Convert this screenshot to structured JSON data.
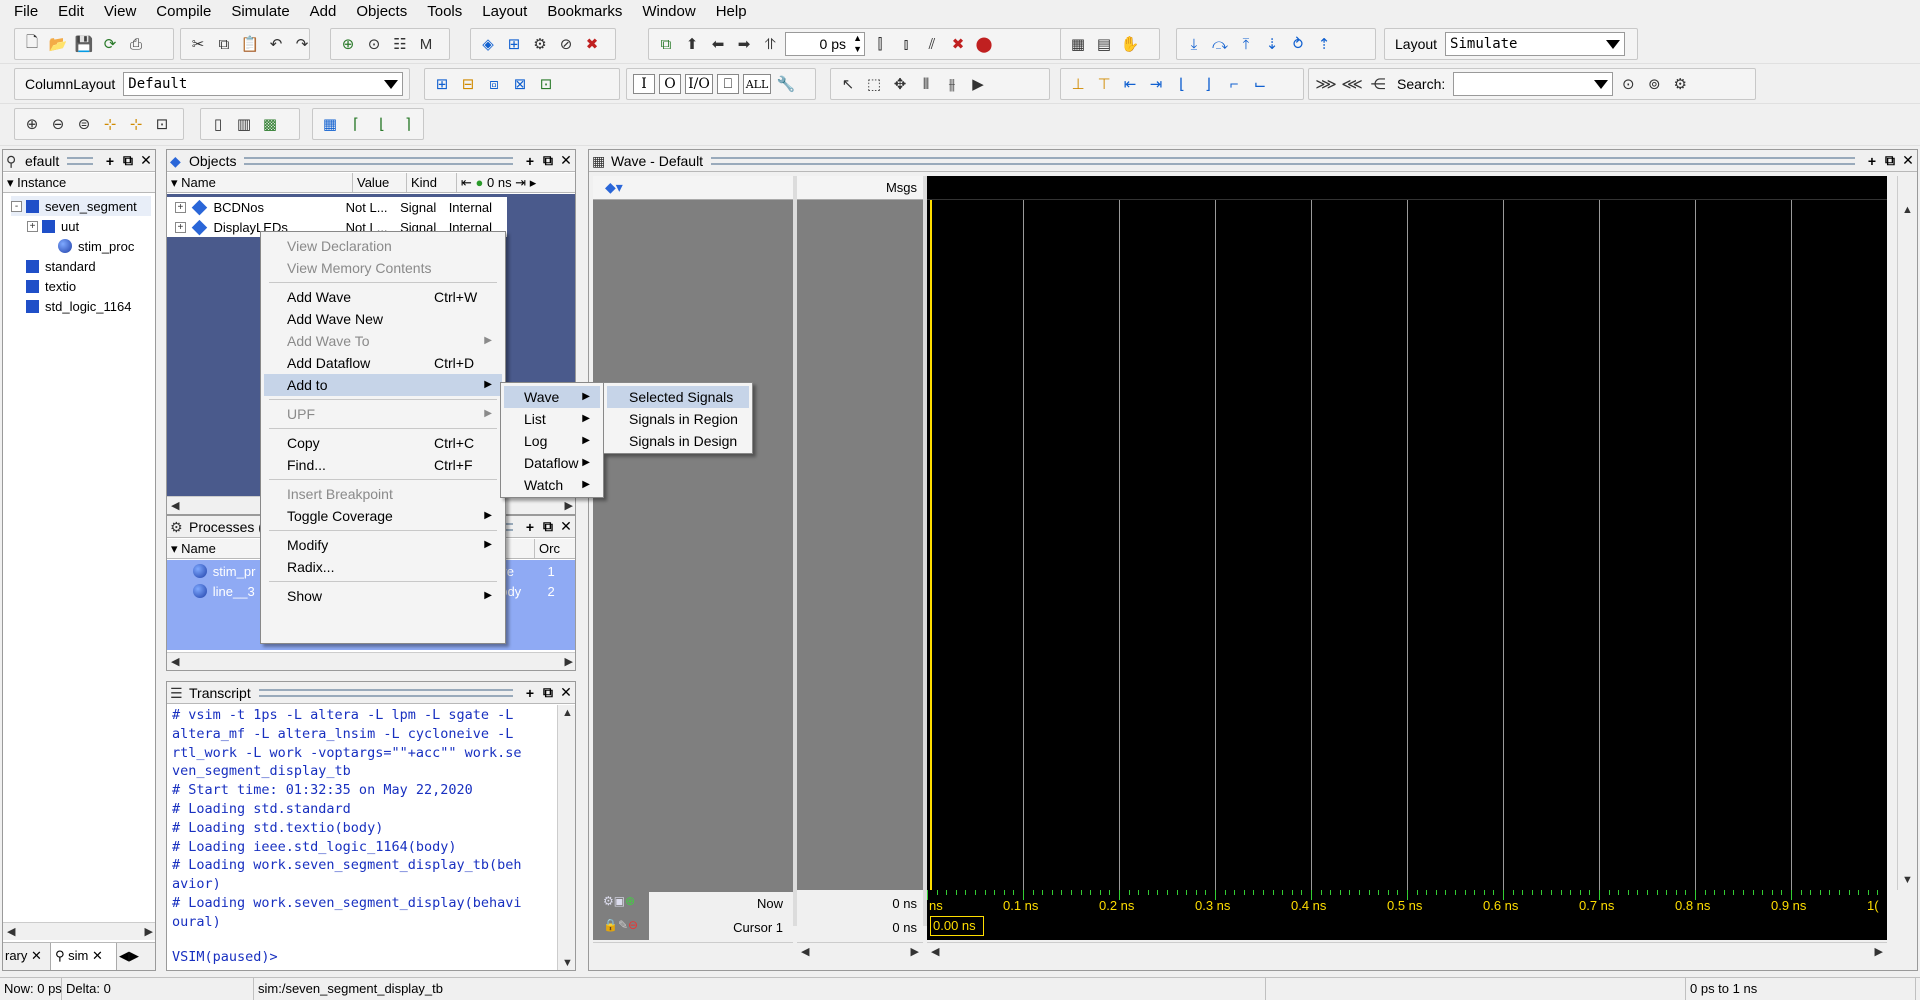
{
  "menubar": [
    "File",
    "Edit",
    "View",
    "Compile",
    "Simulate",
    "Add",
    "Objects",
    "Tools",
    "Layout",
    "Bookmarks",
    "Window",
    "Help"
  ],
  "toolbar": {
    "time_value": "0 ps",
    "layout_label": "Layout",
    "layout_value": "Simulate",
    "column_layout_label": "ColumnLayout",
    "column_layout_value": "Default",
    "search_label": "Search:",
    "search_placeholder": "",
    "btn_I": "I",
    "btn_O": "O",
    "btn_IO": "I/O",
    "btn_ALL": "ALL"
  },
  "instance_panel": {
    "title": "efault",
    "header": "Instance",
    "tabs": [
      "rary",
      "sim"
    ],
    "tree": [
      {
        "label": "seven_segment",
        "indent": 0,
        "icon": "square",
        "expander": "-"
      },
      {
        "label": "uut",
        "indent": 1,
        "icon": "square",
        "expander": "+"
      },
      {
        "label": "stim_proc",
        "indent": 2,
        "icon": "circle",
        "expander": ""
      },
      {
        "label": "standard",
        "indent": 0,
        "icon": "square",
        "expander": ""
      },
      {
        "label": "textio",
        "indent": 0,
        "icon": "square",
        "expander": ""
      },
      {
        "label": "std_logic_1164",
        "indent": 0,
        "icon": "square",
        "expander": ""
      }
    ]
  },
  "objects_panel": {
    "title": "Objects",
    "columns": [
      "Name",
      "Value",
      "Kind"
    ],
    "header_time": "0 ns",
    "rows": [
      {
        "name": "BCDNos",
        "value": "Not L...",
        "kind": "Signal",
        "mode": "Internal"
      },
      {
        "name": "DisplayLEDs",
        "value": "Not L...",
        "kind": "Signal",
        "mode": "Internal"
      }
    ]
  },
  "processes_panel": {
    "title": "Processes (",
    "columns": [
      "Name",
      "te",
      "Orc"
    ],
    "rows": [
      {
        "name": "stim_pr",
        "state": "ve",
        "order": "1"
      },
      {
        "name": "line__3",
        "state": "ody",
        "order": "2"
      }
    ]
  },
  "transcript_panel": {
    "title": "Transcript",
    "lines": [
      "# vsim -t 1ps -L altera -L lpm -L sgate -L",
      "altera_mf -L altera_lnsim -L cycloneive -L",
      "rtl_work -L work -voptargs=\"\"+acc\"\" work.se",
      "ven_segment_display_tb",
      "# Start time: 01:32:35 on May 22,2020",
      "# Loading std.standard",
      "# Loading std.textio(body)",
      "# Loading ieee.std_logic_1164(body)",
      "# Loading work.seven_segment_display_tb(beh",
      "avior)",
      "# Loading work.seven_segment_display(behavi",
      "oural)"
    ],
    "prompt": "VSIM(paused)>"
  },
  "context_menu": {
    "items": [
      {
        "label": "View Declaration",
        "shortcut": "",
        "disabled": true,
        "submenu": false
      },
      {
        "label": "View Memory Contents",
        "shortcut": "",
        "disabled": true,
        "submenu": false
      },
      {
        "sep": true
      },
      {
        "label": "Add Wave",
        "shortcut": "Ctrl+W",
        "disabled": false,
        "submenu": false
      },
      {
        "label": "Add Wave New",
        "shortcut": "",
        "disabled": false,
        "submenu": false
      },
      {
        "label": "Add Wave To",
        "shortcut": "",
        "disabled": true,
        "submenu": true
      },
      {
        "label": "Add Dataflow",
        "shortcut": "Ctrl+D",
        "disabled": false,
        "submenu": false
      },
      {
        "label": "Add to",
        "shortcut": "",
        "disabled": false,
        "submenu": true,
        "selected": true
      },
      {
        "sep": true
      },
      {
        "label": "UPF",
        "shortcut": "",
        "disabled": true,
        "submenu": true
      },
      {
        "sep": true
      },
      {
        "label": "Copy",
        "shortcut": "Ctrl+C",
        "disabled": false,
        "submenu": false
      },
      {
        "label": "Find...",
        "shortcut": "Ctrl+F",
        "disabled": false,
        "submenu": false
      },
      {
        "sep": true
      },
      {
        "label": "Insert Breakpoint",
        "shortcut": "",
        "disabled": true,
        "submenu": false
      },
      {
        "label": "Toggle Coverage",
        "shortcut": "",
        "disabled": false,
        "submenu": true
      },
      {
        "sep": true
      },
      {
        "label": "Modify",
        "shortcut": "",
        "disabled": false,
        "submenu": true
      },
      {
        "label": "Radix...",
        "shortcut": "",
        "disabled": false,
        "submenu": false
      },
      {
        "sep": true
      },
      {
        "label": "Show",
        "shortcut": "",
        "disabled": false,
        "submenu": true
      }
    ]
  },
  "submenu_addto": {
    "items": [
      {
        "label": "Wave",
        "selected": true
      },
      {
        "label": "List",
        "selected": false
      },
      {
        "label": "Log",
        "selected": false
      },
      {
        "label": "Dataflow",
        "selected": false
      },
      {
        "label": "Watch",
        "selected": false
      }
    ]
  },
  "submenu_wave": {
    "items": [
      {
        "label": "Selected Signals",
        "selected": true
      },
      {
        "label": "Signals in Region",
        "selected": false
      },
      {
        "label": "Signals in Design",
        "selected": false
      }
    ]
  },
  "wave_panel": {
    "title": "Wave - Default",
    "msgs_label": "Msgs",
    "now_label": "Now",
    "now_value": "0 ns",
    "cursor_label": "Cursor 1",
    "cursor_value": "0 ns",
    "cursor_time": "0.00 ns",
    "tick_labels": [
      "ns",
      "0.1 ns",
      "0.2 ns",
      "0.3 ns",
      "0.4 ns",
      "0.5 ns",
      "0.6 ns",
      "0.7 ns",
      "0.8 ns",
      "0.9 ns",
      "1("
    ],
    "colors": {
      "background": "#000000",
      "grid": "#9a9a9a",
      "cursor": "#ffde00",
      "names_bg": "#7f7f7f"
    }
  },
  "statusbar": {
    "now": "Now: 0 ps",
    "delta": "Delta: 0",
    "path": "sim:/seven_segment_display_tb",
    "range": "0 ps to 1 ns"
  }
}
